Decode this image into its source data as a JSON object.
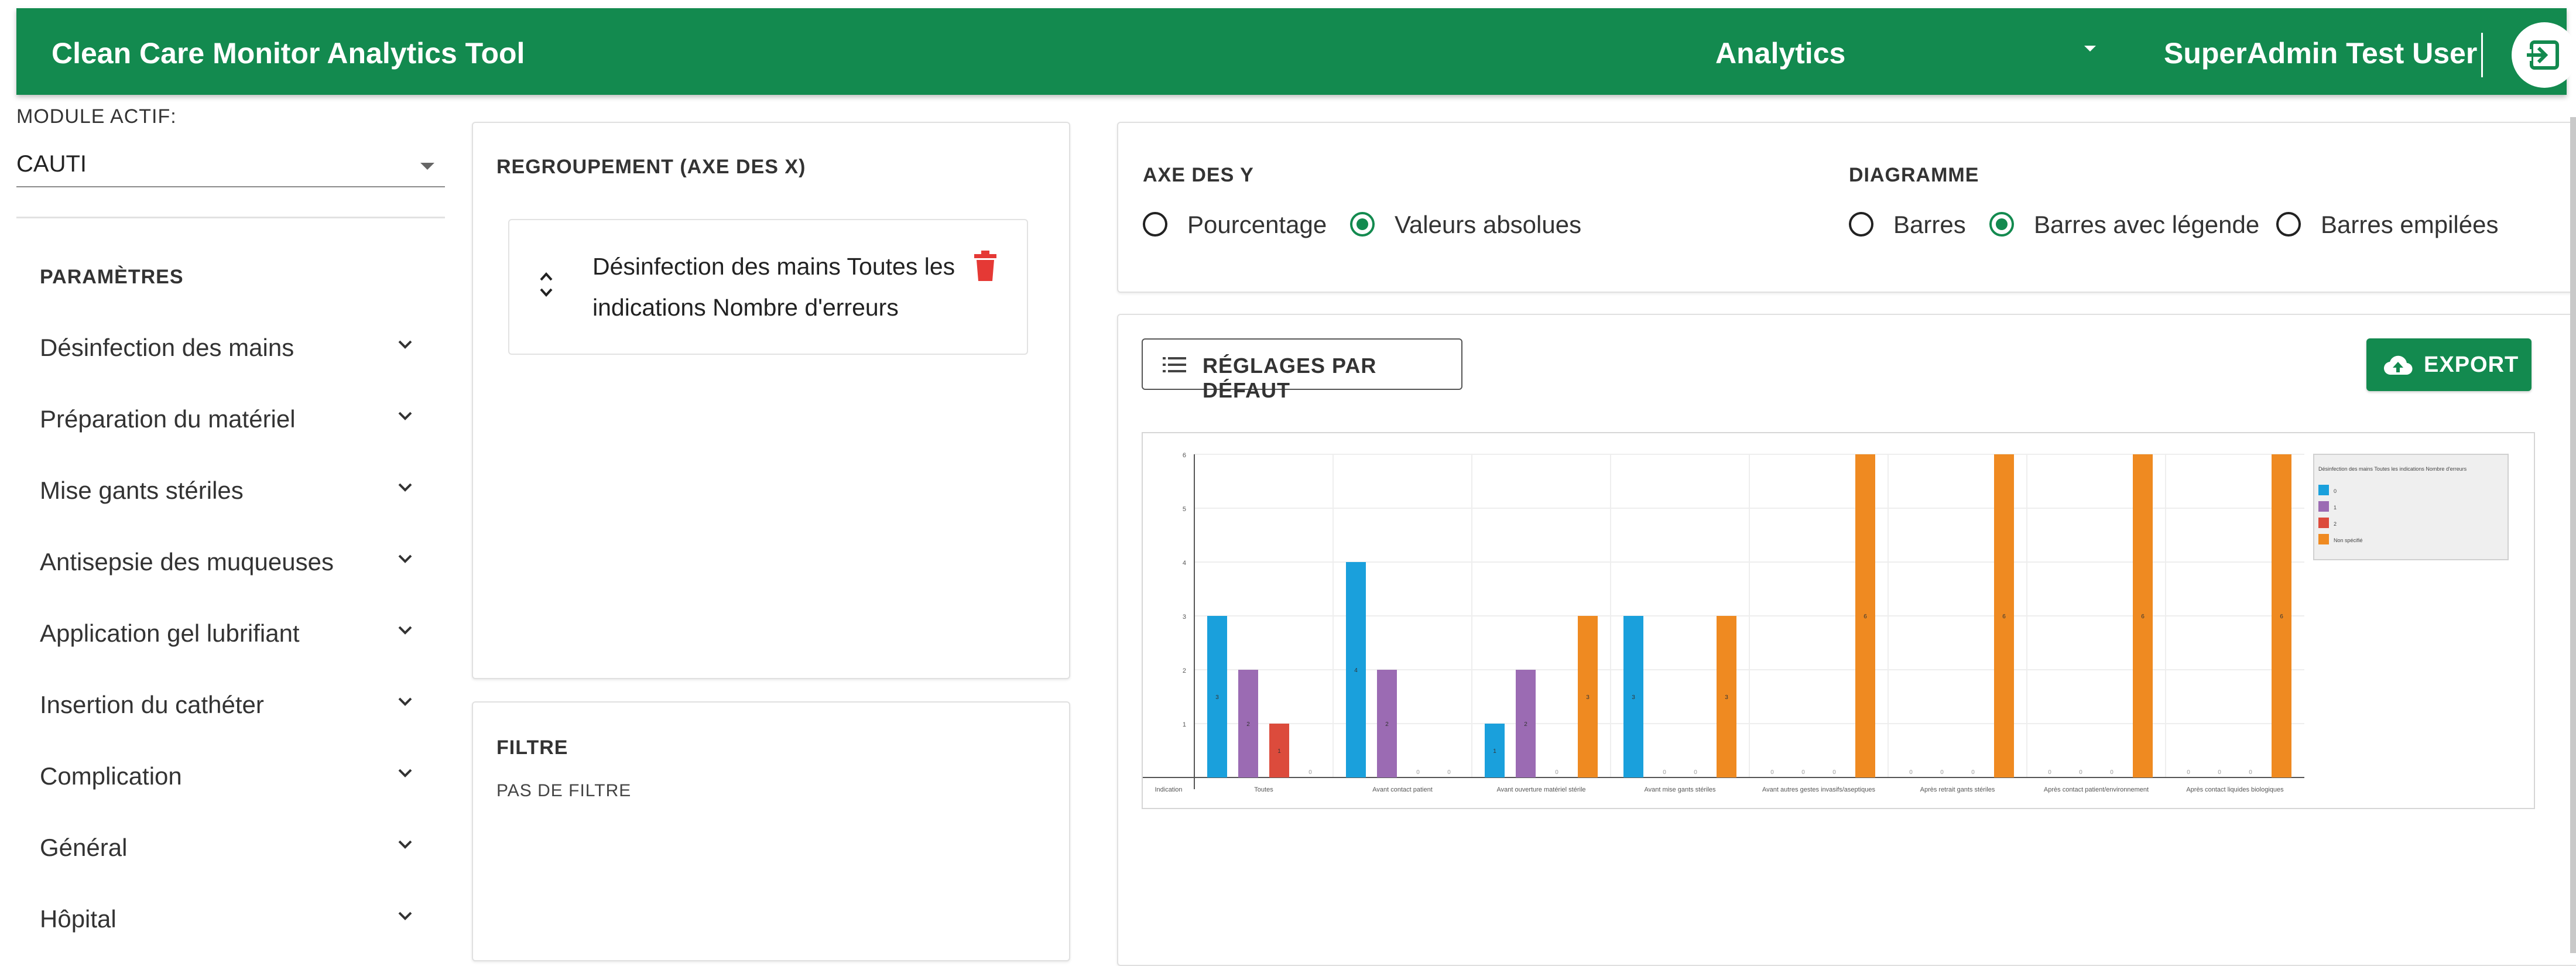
{
  "header": {
    "app_title": "Clean Care Monitor Analytics Tool",
    "module_nav": "Analytics",
    "user_name": "SuperAdmin Test User",
    "logout_icon": "logout-icon"
  },
  "sidebar": {
    "module_label": "MODULE ACTIF:",
    "module_value": "CAUTI",
    "params_title": "PARAMÈTRES",
    "items": [
      {
        "label": "Désinfection des mains"
      },
      {
        "label": "Préparation du matériel"
      },
      {
        "label": "Mise gants stériles"
      },
      {
        "label": "Antisepsie des muqueuses"
      },
      {
        "label": "Application gel lubrifiant"
      },
      {
        "label": "Insertion du cathéter"
      },
      {
        "label": "Complication"
      },
      {
        "label": "Général"
      },
      {
        "label": "Hôpital"
      }
    ]
  },
  "grouping": {
    "title": "REGROUPEMENT (AXE DES X)",
    "item_text": "Désinfection des mains Toutes les indications Nombre d'erreurs"
  },
  "filter": {
    "title": "FILTRE",
    "empty_text": "PAS DE FILTRE"
  },
  "options": {
    "y_axis_title": "AXE DES Y",
    "y_axis_options": [
      {
        "label": "Pourcentage",
        "selected": false
      },
      {
        "label": "Valeurs absolues",
        "selected": true
      }
    ],
    "chart_title": "DIAGRAMME",
    "chart_options": [
      {
        "label": "Barres",
        "selected": false
      },
      {
        "label": "Barres avec légende",
        "selected": true
      },
      {
        "label": "Barres empilées",
        "selected": false
      }
    ]
  },
  "toolbar": {
    "default_settings_label": "RÉGLAGES PAR DÉFAUT",
    "export_label": "EXPORT"
  },
  "colors": {
    "brand_green": "#138a4f",
    "delete_red": "#e53935"
  },
  "chart_data": {
    "type": "bar",
    "x_axis_label": "Indication",
    "categories": [
      "Toutes",
      "Avant contact patient",
      "Avant ouverture matériel stérile",
      "Avant mise gants stériles",
      "Avant autres gestes invasifs/aseptiques",
      "Après retrait gants stériles",
      "Après contact patient/environnement",
      "Après contact liquides biologiques"
    ],
    "series": [
      {
        "name": "0",
        "color": "#1aa0dc",
        "values": [
          3,
          4,
          1,
          3,
          0,
          0,
          0,
          0
        ]
      },
      {
        "name": "1",
        "color": "#9b6bb3",
        "values": [
          2,
          2,
          2,
          0,
          0,
          0,
          0,
          0
        ]
      },
      {
        "name": "2",
        "color": "#dc4b3c",
        "values": [
          1,
          0,
          0,
          0,
          0,
          0,
          0,
          0
        ]
      },
      {
        "name": "Non spécifié",
        "color": "#ef8a21",
        "values": [
          0,
          0,
          3,
          3,
          6,
          6,
          6,
          6
        ]
      }
    ],
    "ylim": [
      0,
      6
    ],
    "yticks": [
      1,
      2,
      3,
      4,
      5,
      6
    ],
    "legend_title": "Désinfection des mains Toutes les indications Nombre d'erreurs",
    "legend_position": "top-right",
    "grid": true
  }
}
